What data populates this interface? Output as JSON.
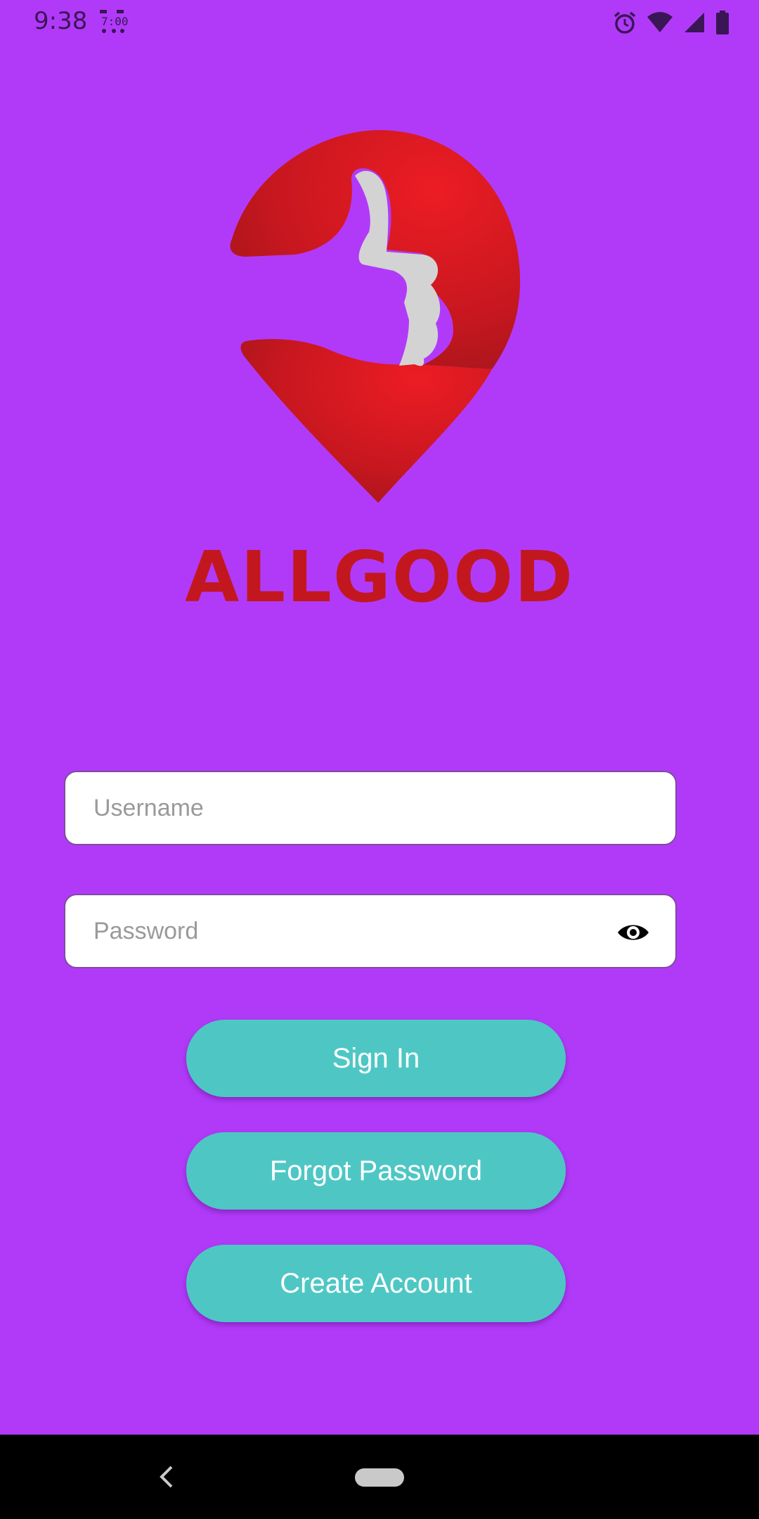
{
  "status_bar": {
    "time": "9:38",
    "app_icon": "clock-widget-icon",
    "icons": [
      "alarm-icon",
      "wifi-icon",
      "signal-icon",
      "battery-icon"
    ]
  },
  "brand": {
    "name": "ALLGOOD",
    "logo_icon": "thumbs-up-pin-logo",
    "color": "#c3171f"
  },
  "form": {
    "username_placeholder": "Username",
    "username_value": "",
    "password_placeholder": "Password",
    "password_value": "",
    "visibility_icon": "eye-icon"
  },
  "actions": {
    "sign_in": "Sign In",
    "forgot_password": "Forgot Password",
    "create_account": "Create Account"
  },
  "colors": {
    "background": "#b13af9",
    "button": "#4ec7c4",
    "button_text": "#ffffff"
  },
  "nav_bar": {
    "back_icon": "back-chevron-icon",
    "home_icon": "home-pill-icon"
  }
}
